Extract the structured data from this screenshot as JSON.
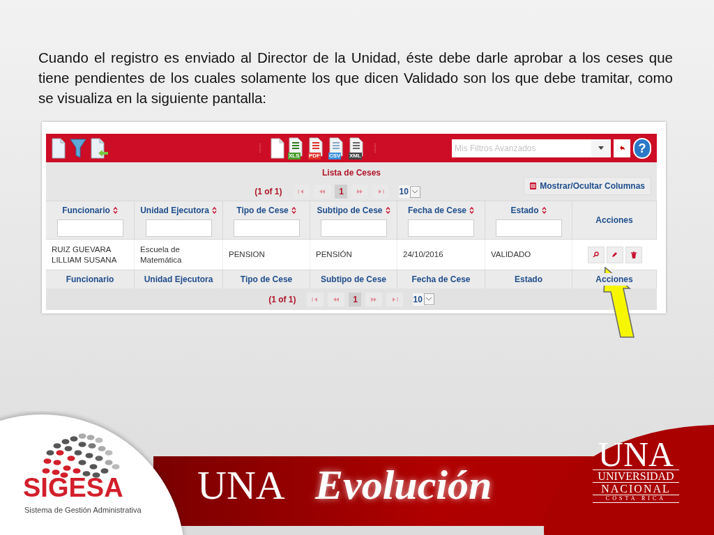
{
  "slide": {
    "paragraph": "Cuando el registro es enviado al Director de la Unidad, éste debe darle aprobar a los ceses que tiene pendientes de los cuales solamente los que dicen Validado son los que debe tramitar, como se visualiza en la siguiente pantalla:"
  },
  "toolbar": {
    "exports": [
      {
        "kind": "xls",
        "label": "XLS"
      },
      {
        "kind": "pdf",
        "label": "PDF"
      },
      {
        "kind": "csv",
        "label": "CSV"
      },
      {
        "kind": "xml",
        "label": "XML"
      }
    ],
    "filter_placeholder": "Mis Filtros Avanzados",
    "help": "?"
  },
  "table": {
    "caption": "Lista de Ceses",
    "column_toggle": "Mostrar/Ocultar Columnas",
    "paginator_top": {
      "summary": "(1 of 1)",
      "pages": [
        {
          "label": "1",
          "selected": true
        }
      ],
      "rows_per_page": "10"
    },
    "columns": [
      {
        "label": "Funcionario",
        "kind": "filter"
      },
      {
        "label": "Unidad Ejecutora",
        "kind": "filter"
      },
      {
        "label": "Tipo de Cese",
        "kind": "filter"
      },
      {
        "label": "Subtipo de Cese",
        "kind": "filter"
      },
      {
        "label": "Fecha de Cese",
        "kind": "filter"
      },
      {
        "label": "Estado",
        "kind": "filter"
      },
      {
        "label": "Acciones",
        "kind": "actions"
      }
    ],
    "rows": [
      {
        "cells": [
          "RUIZ GUEVARA\nLILLIAM SUSANA",
          "Escuela de\nMatemática",
          "PENSION",
          "PENSIÓN",
          "24/10/2016",
          "VALIDADO"
        ]
      }
    ],
    "footer_columns": [
      "Funcionario",
      "Unidad Ejecutora",
      "Tipo de Cese",
      "Subtipo de Cese",
      "Fecha de Cese",
      "Estado",
      "Acciones"
    ],
    "paginator_bottom": {
      "summary": "(1 of 1)",
      "pages": [
        {
          "label": "1",
          "selected": true
        }
      ],
      "rows_per_page": "10"
    }
  },
  "footer": {
    "sigesa": "SIGESA",
    "sigesa_subtitle": "Sistema de Gestión Administrativa",
    "una": "UNA",
    "evolucion": "Evolución",
    "logo_una": "UNA",
    "logo_lines": [
      "UNIVERSIDAD",
      "NACIONAL",
      "COSTA RICA"
    ]
  }
}
